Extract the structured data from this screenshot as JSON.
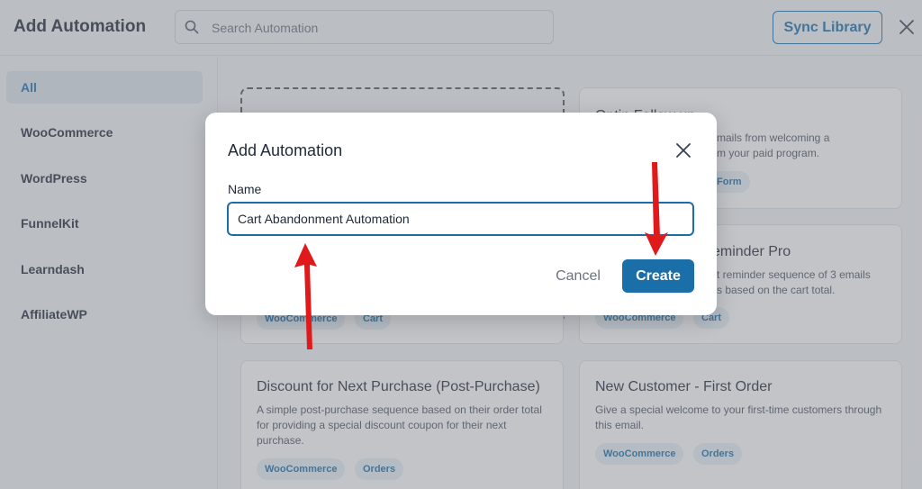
{
  "header": {
    "title": "Add Automation",
    "search_placeholder": "Search Automation",
    "sync_label": "Sync Library"
  },
  "sidebar": {
    "items": [
      {
        "label": "All",
        "active": true
      },
      {
        "label": "WooCommerce"
      },
      {
        "label": "WordPress"
      },
      {
        "label": "FunnelKit"
      },
      {
        "label": "Learndash"
      },
      {
        "label": "AffiliateWP"
      }
    ]
  },
  "cards": {
    "optin": {
      "title": "Optin Follow up",
      "desc": "mails from welcoming a\nm your paid program.",
      "tag": "Form"
    },
    "reminder": {
      "title": "eminder Pro",
      "desc": "t reminder sequence of 3 emails\ns based on the cart total.",
      "tags": [
        "WooCommerce",
        "Cart"
      ]
    },
    "left_mid_tags": [
      "WooCommerce",
      "Cart"
    ],
    "discount": {
      "title": "Discount for Next Purchase (Post-Purchase)",
      "desc": "A simple post-purchase sequence based on their order total for providing a special discount coupon for their next purchase.",
      "tags": [
        "WooCommerce",
        "Orders"
      ]
    },
    "new_customer": {
      "title": "New Customer - First Order",
      "desc": "Give a special welcome to your first-time customers through this email.",
      "tags": [
        "WooCommerce",
        "Orders"
      ]
    }
  },
  "modal": {
    "title": "Add Automation",
    "name_label": "Name",
    "name_value": "Cart Abandonment Automation",
    "cancel_label": "Cancel",
    "create_label": "Create"
  },
  "colors": {
    "primary": "#1b6fa8",
    "arrow": "#e0191b",
    "overlay": "rgba(120,125,132,0.45)"
  },
  "icons": [
    "search-icon",
    "close-icon",
    "modal-close-icon",
    "arrow-annotation"
  ]
}
